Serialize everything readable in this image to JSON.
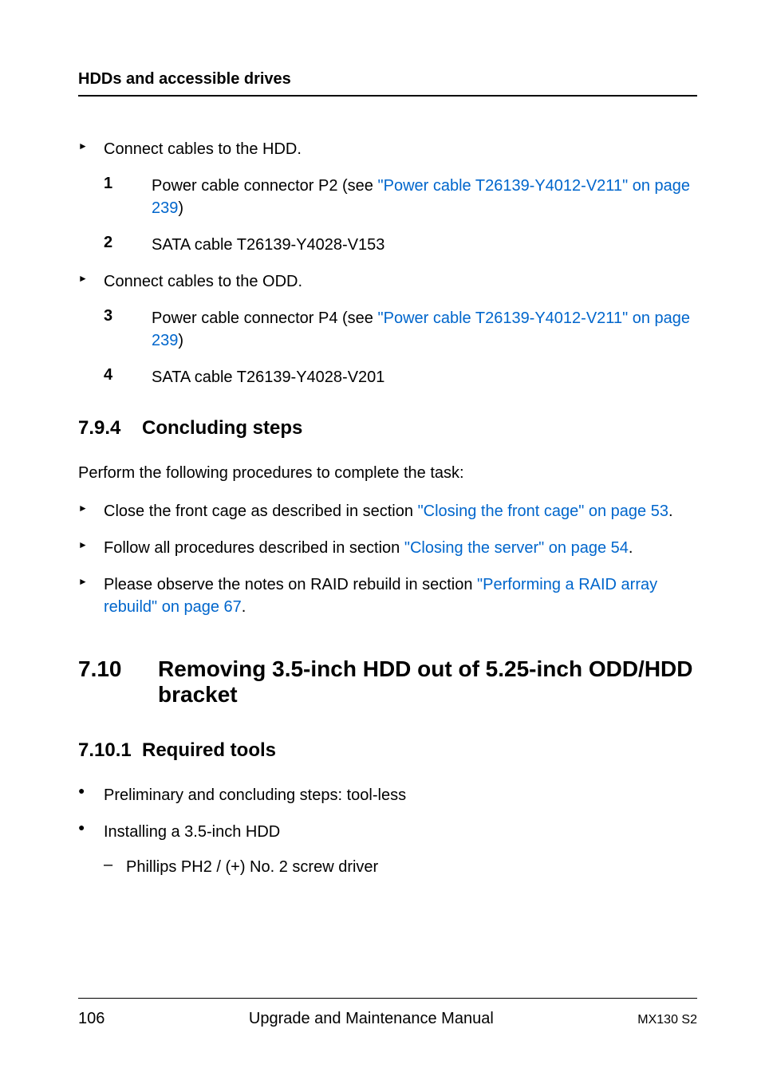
{
  "header": {
    "title": "HDDs and accessible drives"
  },
  "content": {
    "bullet1_text": "Connect cables to the HDD.",
    "num1": {
      "marker": "1",
      "prefix": "Power cable connector P2 (see ",
      "link": "\"Power cable T26139-Y4012-V211\" on page 239",
      "suffix": ")"
    },
    "num2": {
      "marker": "2",
      "text": "SATA cable T26139-Y4028-V153"
    },
    "bullet2_text": "Connect cables to the ODD.",
    "num3": {
      "marker": "3",
      "prefix": "Power cable connector P4 (see ",
      "link": "\"Power cable T26139-Y4012-V211\" on page 239",
      "suffix": ")"
    },
    "num4": {
      "marker": "4",
      "text": "SATA cable T26139-Y4028-V201"
    },
    "section_794": {
      "number": "7.9.4",
      "title": "Concluding steps"
    },
    "para1": "Perform the following procedures to complete the task:",
    "step1": {
      "prefix": "Close the front cage as described in section ",
      "link": "\"Closing the front cage\" on page 53",
      "suffix": "."
    },
    "step2": {
      "prefix": "Follow all procedures described in section ",
      "link": "\"Closing the server\" on page 54",
      "suffix": "."
    },
    "step3": {
      "prefix": "Please observe the notes on RAID rebuild in section ",
      "link": "\"Performing a RAID array rebuild\" on page 67",
      "suffix": "."
    },
    "section_710": {
      "number": "7.10",
      "title": "Removing 3.5-inch HDD out of 5.25-inch ODD/HDD bracket"
    },
    "section_7101": {
      "number": "7.10.1",
      "title": "Required tools"
    },
    "tool1": "Preliminary and concluding steps: tool-less",
    "tool2": "Installing a 3.5-inch HDD",
    "tool2_sub": "Phillips PH2 / (+) No. 2 screw driver"
  },
  "footer": {
    "page": "106",
    "center": "Upgrade and Maintenance Manual",
    "right": "MX130 S2"
  }
}
